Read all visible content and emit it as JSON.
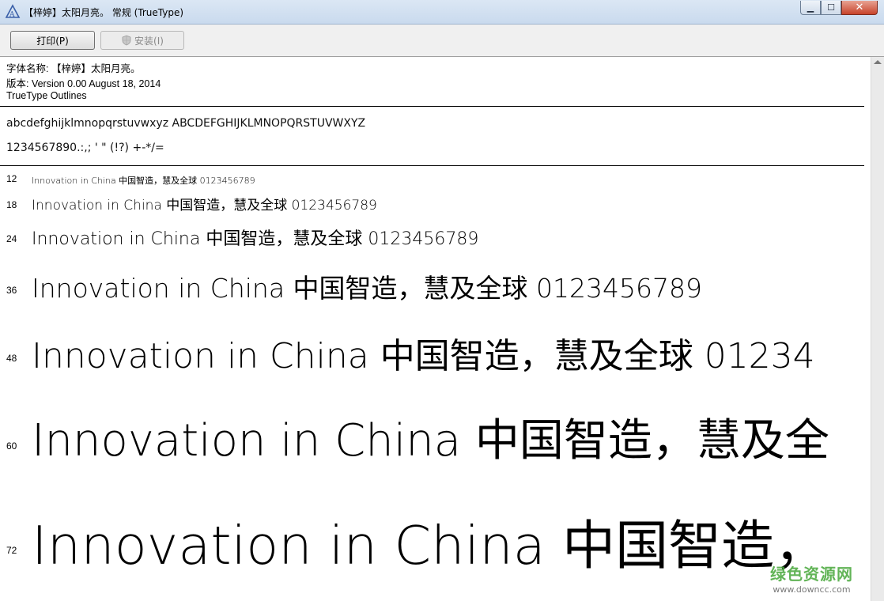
{
  "window": {
    "title": "【梓婷】太阳月亮。 常规 (TrueType)",
    "minimize_label": "▁",
    "maximize_label": "☐",
    "close_label": "✕"
  },
  "toolbar": {
    "print_label": "打印(P)",
    "install_label": "安装(I)"
  },
  "font_info": {
    "name_line": "字体名称: 【梓婷】太阳月亮。",
    "version_line": "版本: Version 0.00 August 18, 2014",
    "outline_line": "TrueType Outlines"
  },
  "charset": {
    "letters": "abcdefghijklmnopqrstuvwxyz ABCDEFGHIJKLMNOPQRSTUVWXYZ",
    "digits_symbols": "1234567890.:,; ' \" (!?) +-*/="
  },
  "samples": {
    "text": "Innovation in China 中国智造，慧及全球 0123456789",
    "sizes": [
      {
        "label": "12",
        "text": "Innovation in China 中国智造，慧及全球 0123456789"
      },
      {
        "label": "18",
        "text": "Innovation in China 中国智造，慧及全球 0123456789"
      },
      {
        "label": "24",
        "text": "Innovation in China 中国智造，慧及全球 0123456789"
      },
      {
        "label": "36",
        "text": "Innovation in China 中国智造，慧及全球 0123456789"
      },
      {
        "label": "48",
        "text": "Innovation in China 中国智造，慧及全球 01234"
      },
      {
        "label": "60",
        "text": "Innovation in China 中国智造，慧及全"
      },
      {
        "label": "72",
        "text": "Innovation in China 中国智造，"
      }
    ]
  },
  "watermark": {
    "cn": "绿色资源网",
    "url": "www.downcc.com"
  }
}
